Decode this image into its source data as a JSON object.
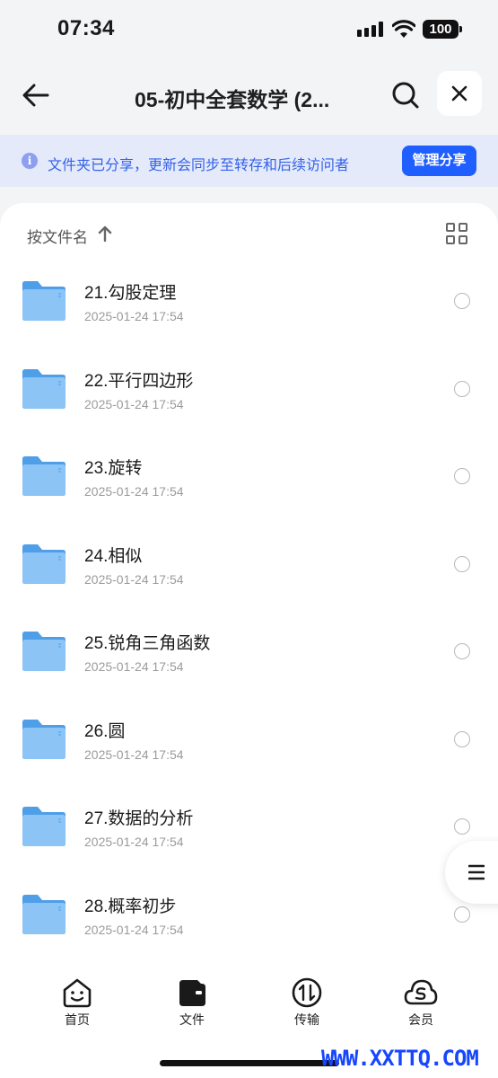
{
  "status_bar": {
    "time": "07:34",
    "battery": "100"
  },
  "nav": {
    "title": "05-初中全套数学 (2...",
    "icons": [
      "back-arrow-icon",
      "search-icon",
      "close-icon"
    ]
  },
  "share_banner": {
    "info_icon": "i",
    "text": "文件夹已分享，更新会同步至转存和后续访问者",
    "manage_label": "管理分享"
  },
  "sort": {
    "label": "按文件名",
    "direction": "ascending"
  },
  "files": [
    {
      "name": "21.勾股定理",
      "date": "2025-01-24 17:54"
    },
    {
      "name": "22.平行四边形",
      "date": "2025-01-24 17:54"
    },
    {
      "name": "23.旋转",
      "date": "2025-01-24 17:54"
    },
    {
      "name": "24.相似",
      "date": "2025-01-24 17:54"
    },
    {
      "name": "25.锐角三角函数",
      "date": "2025-01-24 17:54"
    },
    {
      "name": "26.圆",
      "date": "2025-01-24 17:54"
    },
    {
      "name": "27.数据的分析",
      "date": "2025-01-24 17:54"
    },
    {
      "name": "28.概率初步",
      "date": "2025-01-24 17:54"
    }
  ],
  "tabs": [
    {
      "label": "首页",
      "icon": "home-face-icon"
    },
    {
      "label": "文件",
      "icon": "files-wallet-icon",
      "active": true
    },
    {
      "label": "传输",
      "icon": "transfer-icon"
    },
    {
      "label": "会员",
      "icon": "member-cloud-icon"
    }
  ],
  "watermark": "WWW.XXTTQ.COM",
  "colors": {
    "accent": "#1f5fff",
    "banner_bg": "#e5eafb",
    "banner_text": "#3462e8",
    "folder": "#5aa8f0"
  }
}
